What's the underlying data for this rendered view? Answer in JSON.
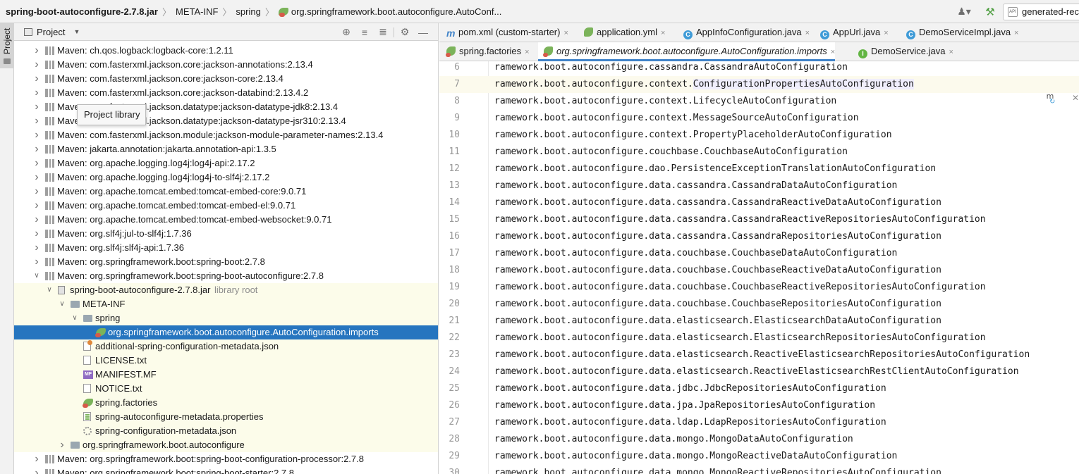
{
  "breadcrumb": {
    "items": [
      "spring-boot-autoconfigure-2.7.8.jar",
      "META-INF",
      "spring",
      "org.springframework.boot.autoconfigure.AutoConf..."
    ]
  },
  "toolbar": {
    "user_icon": "user-icon",
    "build_icon": "hammer-icon",
    "run_config": "generated-rec"
  },
  "stripe": {
    "label": "Project"
  },
  "project_panel": {
    "title": "Project",
    "tools": [
      "locate-icon",
      "expand-all-icon",
      "collapse-all-icon",
      "gear-icon",
      "hide-icon"
    ]
  },
  "tooltip": {
    "text": "Project library"
  },
  "tree": [
    {
      "label": "Maven: ch.qos.logback:logback-core:1.2.11"
    },
    {
      "label": "Maven: com.fasterxml.jackson.core:jackson-annotations:2.13.4"
    },
    {
      "label": "Maven: com.fasterxml.jackson.core:jackson-core:2.13.4"
    },
    {
      "label": "Maven: com.fasterxml.jackson.core:jackson-databind:2.13.4.2"
    },
    {
      "label": "Maven: com.fasterxml.jackson.datatype:jackson-datatype-jdk8:2.13.4"
    },
    {
      "label": "Maven: com.fasterxml.jackson.datatype:jackson-datatype-jsr310:2.13.4"
    },
    {
      "label": "Maven: com.fasterxml.jackson.module:jackson-module-parameter-names:2.13.4"
    },
    {
      "label": "Maven: jakarta.annotation:jakarta.annotation-api:1.3.5"
    },
    {
      "label": "Maven: org.apache.logging.log4j:log4j-api:2.17.2"
    },
    {
      "label": "Maven: org.apache.logging.log4j:log4j-to-slf4j:2.17.2"
    },
    {
      "label": "Maven: org.apache.tomcat.embed:tomcat-embed-core:9.0.71"
    },
    {
      "label": "Maven: org.apache.tomcat.embed:tomcat-embed-el:9.0.71"
    },
    {
      "label": "Maven: org.apache.tomcat.embed:tomcat-embed-websocket:9.0.71"
    },
    {
      "label": "Maven: org.slf4j:jul-to-slf4j:1.7.36"
    },
    {
      "label": "Maven: org.slf4j:slf4j-api:1.7.36"
    },
    {
      "label": "Maven: org.springframework.boot:spring-boot:2.7.8"
    },
    {
      "label": "Maven: org.springframework.boot:spring-boot-autoconfigure:2.7.8"
    },
    {
      "label": "spring-boot-autoconfigure-2.7.8.jar",
      "suffix": "library root"
    },
    {
      "label": "META-INF"
    },
    {
      "label": "spring"
    },
    {
      "label": "org.springframework.boot.autoconfigure.AutoConfiguration.imports"
    },
    {
      "label": "additional-spring-configuration-metadata.json"
    },
    {
      "label": "LICENSE.txt"
    },
    {
      "label": "MANIFEST.MF"
    },
    {
      "label": "NOTICE.txt"
    },
    {
      "label": "spring.factories"
    },
    {
      "label": "spring-autoconfigure-metadata.properties"
    },
    {
      "label": "spring-configuration-metadata.json"
    },
    {
      "label": "org.springframework.boot.autoconfigure"
    },
    {
      "label": "Maven: org.springframework.boot:spring-boot-configuration-processor:2.7.8"
    },
    {
      "label": "Maven: org.springframework.boot:spring-boot-starter:2.7.8"
    }
  ],
  "editor_tabs": {
    "row1": [
      {
        "icon": "maven-icon",
        "title": "pom.xml (custom-starter)"
      },
      {
        "icon": "yaml-icon",
        "title": "application.yml"
      },
      {
        "icon": "class-icon",
        "title": "AppInfoConfiguration.java"
      },
      {
        "icon": "class-icon",
        "title": "AppUrl.java"
      },
      {
        "icon": "class-icon",
        "title": "DemoServiceImpl.java"
      }
    ],
    "row2": [
      {
        "icon": "spring-icon",
        "title": "spring.factories"
      },
      {
        "icon": "spring-icon",
        "title": "org.springframework.boot.autoconfigure.AutoConfiguration.imports",
        "active": true
      },
      {
        "icon": "interface-icon",
        "title": "DemoService.java"
      }
    ]
  },
  "code": [
    {
      "n": "6",
      "text": "ramework.boot.autoconfigure.cassandra.CassandraAutoConfiguration"
    },
    {
      "n": "7",
      "prefix": "ramework.boot.autoconfigure.context.",
      "highlight": "ConfigurationPropertiesAutoConfiguration"
    },
    {
      "n": "8",
      "text": "ramework.boot.autoconfigure.context.LifecycleAutoConfiguration"
    },
    {
      "n": "9",
      "text": "ramework.boot.autoconfigure.context.MessageSourceAutoConfiguration"
    },
    {
      "n": "10",
      "text": "ramework.boot.autoconfigure.context.PropertyPlaceholderAutoConfiguration"
    },
    {
      "n": "11",
      "text": "ramework.boot.autoconfigure.couchbase.CouchbaseAutoConfiguration"
    },
    {
      "n": "12",
      "text": "ramework.boot.autoconfigure.dao.PersistenceExceptionTranslationAutoConfiguration"
    },
    {
      "n": "13",
      "text": "ramework.boot.autoconfigure.data.cassandra.CassandraDataAutoConfiguration"
    },
    {
      "n": "14",
      "text": "ramework.boot.autoconfigure.data.cassandra.CassandraReactiveDataAutoConfiguration"
    },
    {
      "n": "15",
      "text": "ramework.boot.autoconfigure.data.cassandra.CassandraReactiveRepositoriesAutoConfiguration"
    },
    {
      "n": "16",
      "text": "ramework.boot.autoconfigure.data.cassandra.CassandraRepositoriesAutoConfiguration"
    },
    {
      "n": "17",
      "text": "ramework.boot.autoconfigure.data.couchbase.CouchbaseDataAutoConfiguration"
    },
    {
      "n": "18",
      "text": "ramework.boot.autoconfigure.data.couchbase.CouchbaseReactiveDataAutoConfiguration"
    },
    {
      "n": "19",
      "text": "ramework.boot.autoconfigure.data.couchbase.CouchbaseReactiveRepositoriesAutoConfiguration"
    },
    {
      "n": "20",
      "text": "ramework.boot.autoconfigure.data.couchbase.CouchbaseRepositoriesAutoConfiguration"
    },
    {
      "n": "21",
      "text": "ramework.boot.autoconfigure.data.elasticsearch.ElasticsearchDataAutoConfiguration"
    },
    {
      "n": "22",
      "text": "ramework.boot.autoconfigure.data.elasticsearch.ElasticsearchRepositoriesAutoConfiguration"
    },
    {
      "n": "23",
      "text": "ramework.boot.autoconfigure.data.elasticsearch.ReactiveElasticsearchRepositoriesAutoConfiguration"
    },
    {
      "n": "24",
      "text": "ramework.boot.autoconfigure.data.elasticsearch.ReactiveElasticsearchRestClientAutoConfiguration"
    },
    {
      "n": "25",
      "text": "ramework.boot.autoconfigure.data.jdbc.JdbcRepositoriesAutoConfiguration"
    },
    {
      "n": "26",
      "text": "ramework.boot.autoconfigure.data.jpa.JpaRepositoriesAutoConfiguration"
    },
    {
      "n": "27",
      "text": "ramework.boot.autoconfigure.data.ldap.LdapRepositoriesAutoConfiguration"
    },
    {
      "n": "28",
      "text": "ramework.boot.autoconfigure.data.mongo.MongoDataAutoConfiguration"
    },
    {
      "n": "29",
      "text": "ramework.boot.autoconfigure.data.mongo.MongoReactiveDataAutoConfiguration"
    },
    {
      "n": "30",
      "text": "ramework.boot.autoconfigure.data.mongo.MongoReactiveRepositoriesAutoConfiguration"
    }
  ]
}
